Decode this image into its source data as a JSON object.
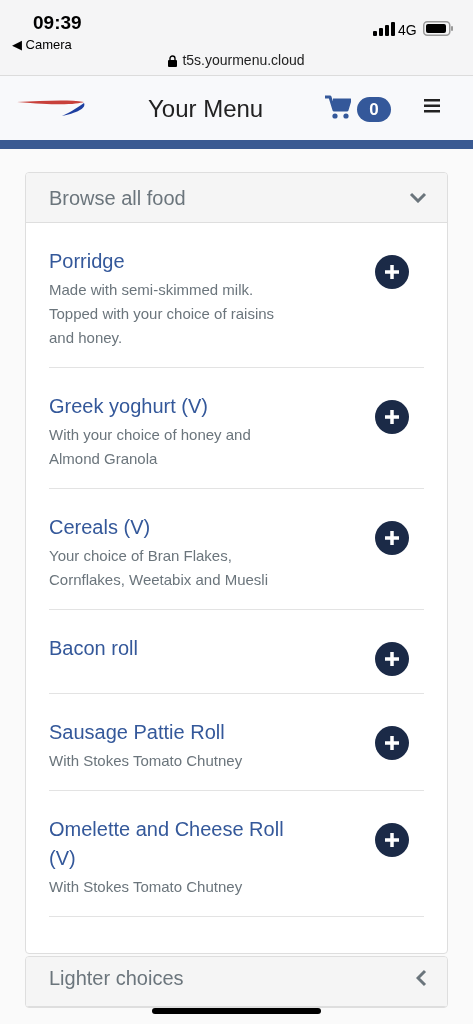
{
  "status_bar": {
    "time": "09:39",
    "back_label": "◀ Camera",
    "network": "4G"
  },
  "address_bar": {
    "url": "t5s.yourmenu.cloud"
  },
  "header": {
    "title": "Your Menu",
    "cart_count": "0"
  },
  "sections": [
    {
      "title": "Browse all food",
      "expanded": true,
      "items": [
        {
          "name": "Porridge",
          "description": "Made with semi-skimmed milk. Topped with your choice of raisins and honey."
        },
        {
          "name": "Greek yoghurt (V)",
          "description": "With your choice of honey and Almond Granola"
        },
        {
          "name": "Cereals (V)",
          "description": "Your choice of Bran Flakes, Cornflakes, Weetabix and Muesli"
        },
        {
          "name": "Bacon roll"
        },
        {
          "name": "Sausage Pattie Roll",
          "description": "With Stokes Tomato Chutney"
        },
        {
          "name": "Omelette and Cheese Roll (V)",
          "description": "With Stokes Tomato Chutney"
        }
      ]
    },
    {
      "title": "Lighter choices",
      "expanded": false
    }
  ]
}
